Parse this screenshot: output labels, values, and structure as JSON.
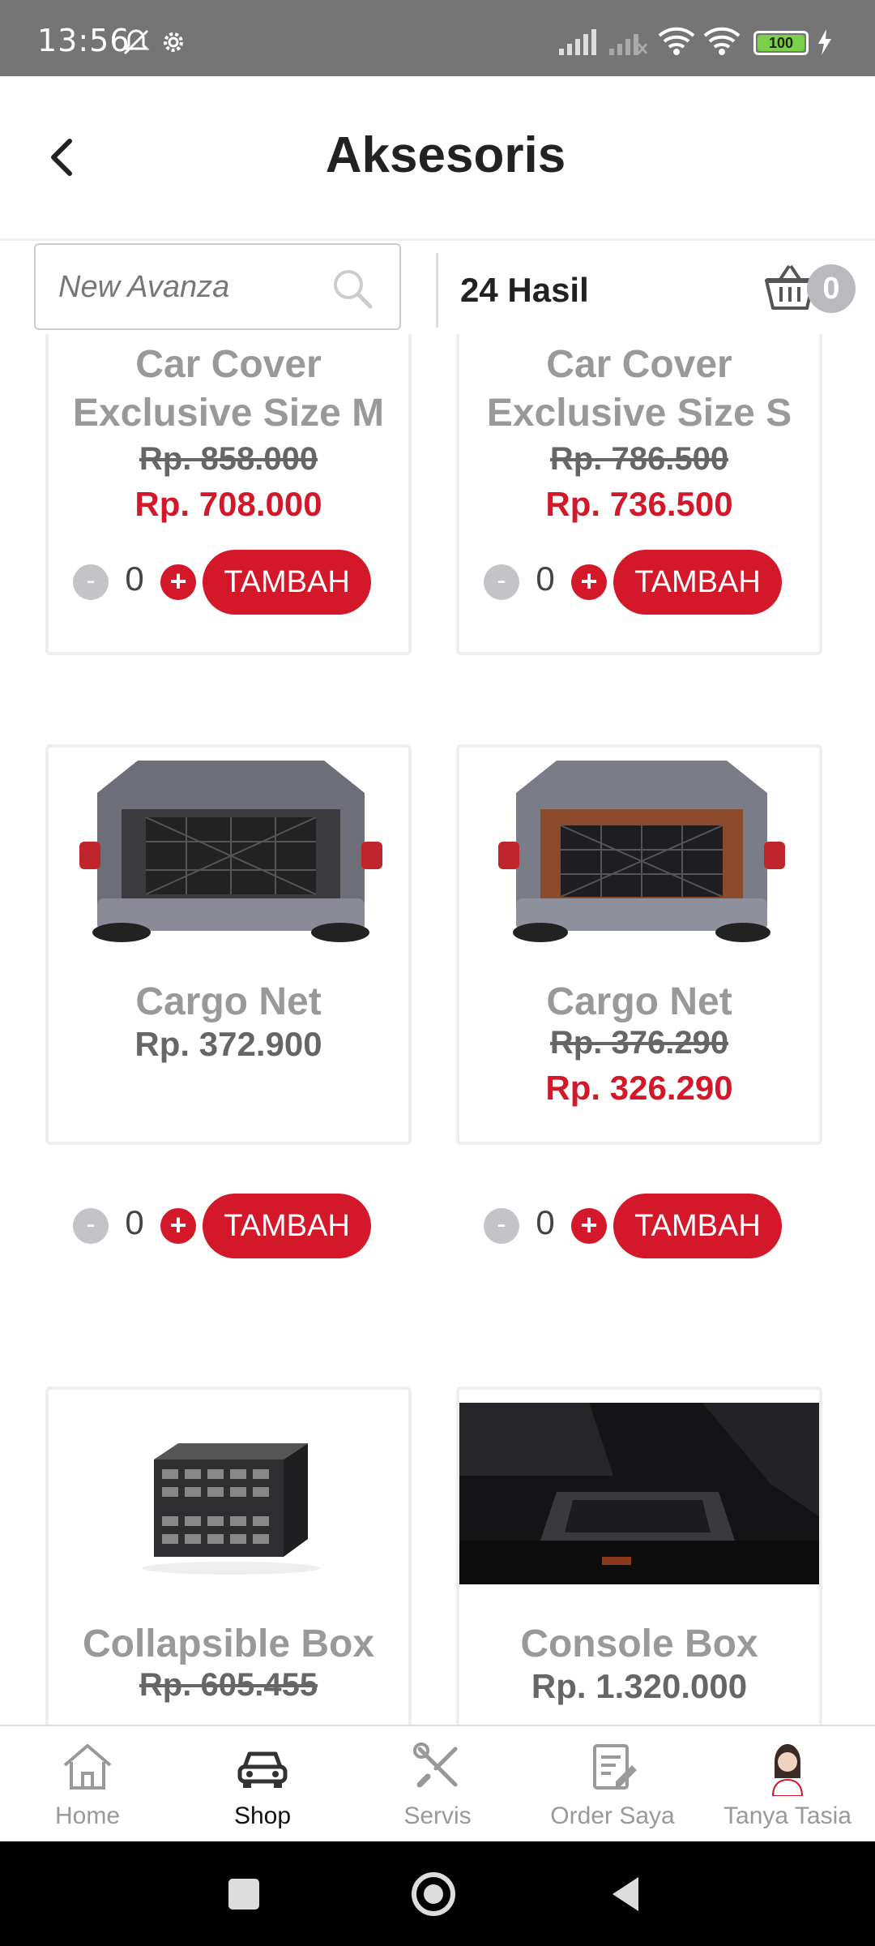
{
  "status_bar": {
    "time": "13:56",
    "battery": "100"
  },
  "header": {
    "title": "Aksesoris"
  },
  "search": {
    "placeholder": "New Avanza"
  },
  "results": {
    "label": "24 Hasil"
  },
  "cart": {
    "count": "0"
  },
  "products": [
    {
      "name_line1": "Car Cover",
      "name_line2": "Exclusive Size M",
      "old_price": "Rp. 858.000",
      "price": "Rp. 708.000",
      "qty": "0",
      "add_label": "TAMBAH"
    },
    {
      "name_line1": "Car Cover",
      "name_line2": "Exclusive Size S",
      "old_price": "Rp. 786.500",
      "price": "Rp. 736.500",
      "qty": "0",
      "add_label": "TAMBAH"
    },
    {
      "name": "Cargo Net",
      "price": "Rp. 372.900",
      "qty": "0",
      "add_label": "TAMBAH"
    },
    {
      "name": "Cargo Net",
      "old_price": "Rp. 376.290",
      "price": "Rp. 326.290",
      "qty": "0",
      "add_label": "TAMBAH"
    },
    {
      "name": "Collapsible Box",
      "old_price": "Rp. 605.455"
    },
    {
      "name": "Console Box",
      "price": "Rp. 1.320.000"
    }
  ],
  "qty_controls": {
    "minus": "-",
    "plus": "+"
  },
  "bottom_nav": [
    {
      "label": "Home",
      "icon": "home-icon"
    },
    {
      "label": "Shop",
      "icon": "car-icon"
    },
    {
      "label": "Servis",
      "icon": "tools-icon"
    },
    {
      "label": "Order Saya",
      "icon": "order-icon"
    },
    {
      "label": "Tanya Tasia",
      "icon": "assistant-avatar"
    }
  ],
  "colors": {
    "accent": "#d3182a",
    "status_bar": "#757575",
    "muted_text": "#999999"
  }
}
